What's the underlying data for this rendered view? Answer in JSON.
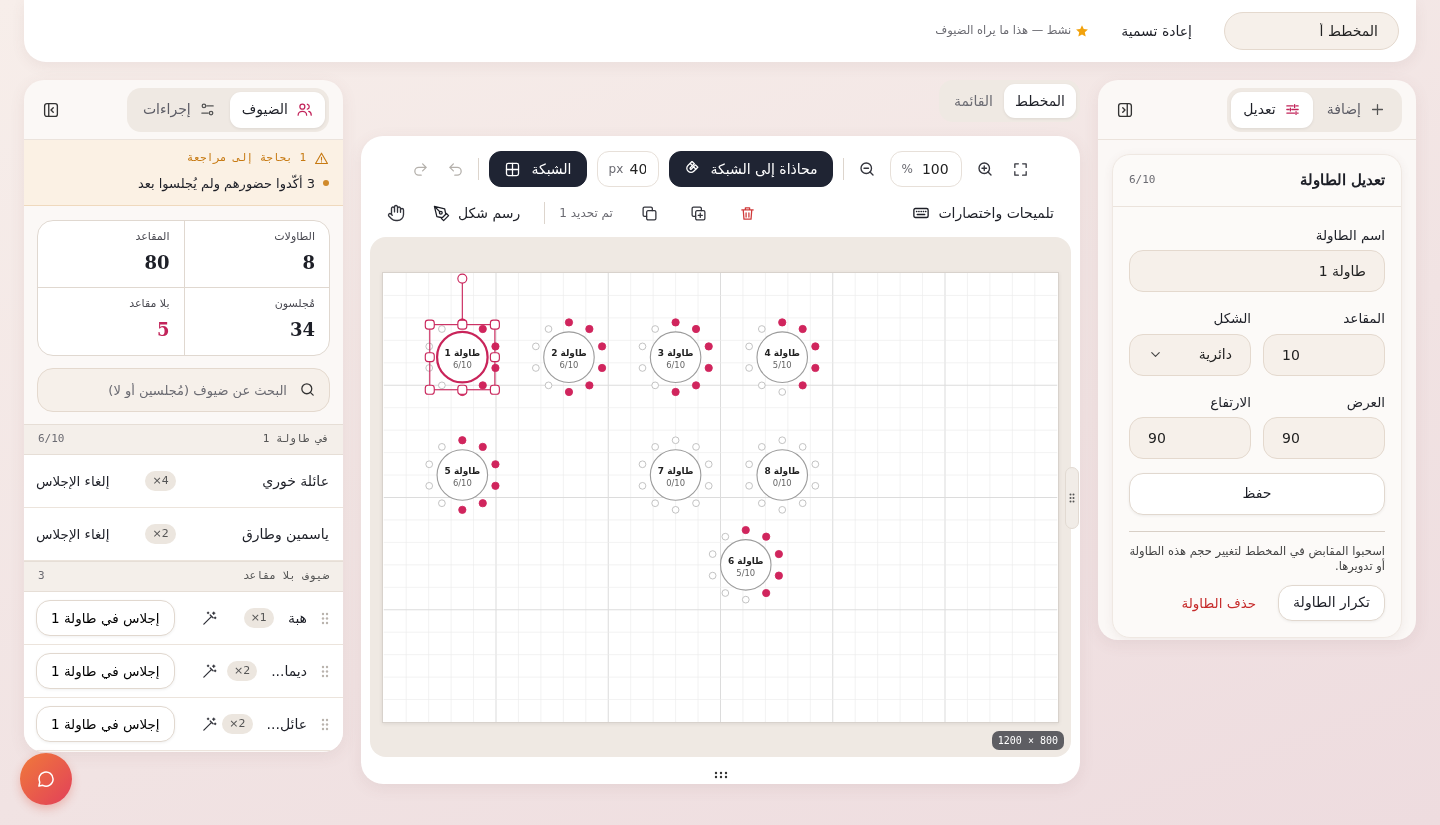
{
  "header": {
    "plan_name": "المخطط أ",
    "rename": "إعادة تسمية",
    "status": "نشط — هذا ما يراه الضيوف"
  },
  "right_panel": {
    "tabs": [
      {
        "label": "إضافة",
        "selected": false
      },
      {
        "label": "تعديل",
        "selected": true
      }
    ],
    "editor": {
      "title": "تعديل الطاولة",
      "count": "6/10",
      "fields": [
        {
          "kind": "text",
          "label": "اسم الطاولة",
          "value": "طاولة 1"
        },
        {
          "kind": "number",
          "label": "المقاعد",
          "value": "10"
        },
        {
          "kind": "select",
          "label": "الشكل",
          "value": "دائرية"
        },
        {
          "kind": "number",
          "label": "العرض",
          "value": "90"
        },
        {
          "kind": "number",
          "label": "الارتفاع",
          "value": "90"
        }
      ],
      "save": "حفظ",
      "hint": "اسحبوا المقابض في المخطط لتغيير حجم هذه الطاولة أو تدويرها.",
      "duplicate": "تكرار الطاولة",
      "delete": "حذف الطاولة"
    }
  },
  "view_tabs": [
    {
      "label": "المخطط",
      "selected": true
    },
    {
      "label": "القائمة",
      "selected": false
    }
  ],
  "toolbar": {
    "zoom": "100",
    "zoom_unit": "%",
    "snap": {
      "label": "محاذاة إلى الشبكة",
      "on": true
    },
    "grid_size": "40",
    "grid_unit": "px",
    "grid": {
      "label": "الشبكة",
      "on": true
    },
    "undo": {
      "disabled": true
    },
    "redo": {
      "disabled": true
    },
    "hints": "تلميحات واختصارات",
    "selection": "تم تحديد 1",
    "draw_shape": "رسم شكل"
  },
  "canvas": {
    "size": "1200 × 800",
    "tables": [
      {
        "name": "طاولة 4",
        "count": "5/10",
        "selected": false,
        "seats_taken": [
          true,
          true,
          true,
          true,
          true,
          false,
          false,
          false,
          false,
          false
        ]
      },
      {
        "name": "طاولة 3",
        "count": "6/10",
        "selected": false,
        "seats_taken": [
          true,
          true,
          true,
          true,
          true,
          true,
          false,
          false,
          false,
          false
        ]
      },
      {
        "name": "طاولة 2",
        "count": "6/10",
        "selected": false,
        "seats_taken": [
          true,
          true,
          true,
          true,
          true,
          true,
          false,
          false,
          false,
          false
        ]
      },
      {
        "name": "طاولة 1",
        "count": "6/10",
        "selected": true,
        "seats_taken": [
          true,
          true,
          true,
          true,
          true,
          true,
          false,
          false,
          false,
          false
        ]
      },
      {
        "name": "طاولة 8",
        "count": "0/10",
        "selected": false,
        "seats_taken": [
          false,
          false,
          false,
          false,
          false,
          false,
          false,
          false,
          false,
          false
        ]
      },
      {
        "name": "طاولة 7",
        "count": "0/10",
        "selected": false,
        "seats_taken": [
          false,
          false,
          false,
          false,
          false,
          false,
          false,
          false,
          false,
          false
        ]
      },
      {
        "name": "طاولة 5",
        "count": "6/10",
        "selected": false,
        "seats_taken": [
          true,
          true,
          true,
          true,
          true,
          true,
          false,
          false,
          false,
          false
        ]
      },
      {
        "name": "طاولة 6",
        "count": "5/10",
        "selected": false,
        "seats_taken": [
          true,
          true,
          true,
          true,
          true,
          false,
          false,
          false,
          false,
          false
        ]
      }
    ]
  },
  "left_panel": {
    "tabs": [
      {
        "label": "الضيوف",
        "selected": true
      },
      {
        "label": "إجراءات",
        "selected": false
      }
    ],
    "alert": {
      "title": "1 بحاجة إلى مراجعة",
      "items": [
        "3 أكّدوا حضورهم ولم يُجلسوا بعد"
      ]
    },
    "stats": [
      {
        "label": "الطاولات",
        "value": "8",
        "highlight": false
      },
      {
        "label": "المقاعد",
        "value": "80",
        "highlight": false
      },
      {
        "label": "مُجلسون",
        "value": "34",
        "highlight": false
      },
      {
        "label": "بلا مقاعد",
        "value": "5",
        "highlight": true
      }
    ],
    "search": {
      "placeholder": "البحث عن ضيوف (مُجلسين أو لا)"
    },
    "sections": [
      {
        "title": "في طاولة 1",
        "count": "6/10",
        "guests": [
          {
            "kind": "seated",
            "name": "عائلة خوري",
            "party": "×4",
            "action": "إلغاء الإجلاس"
          },
          {
            "kind": "seated",
            "name": "ياسمين وطارق",
            "party": "×2",
            "action": "إلغاء الإجلاس"
          }
        ]
      },
      {
        "title": "ضيوف بلا مقاعد",
        "count": "3",
        "guests": [
          {
            "kind": "unseated",
            "name": "هبة",
            "party": "×1",
            "action": "إجلاس في طاولة 1"
          },
          {
            "kind": "unseated",
            "name": "ديما...",
            "party": "×2",
            "action": "إجلاس في طاولة 1"
          },
          {
            "kind": "unseated",
            "name": "عائل...",
            "party": "×2",
            "action": "إجلاس في طاولة 1"
          }
        ]
      }
    ]
  }
}
